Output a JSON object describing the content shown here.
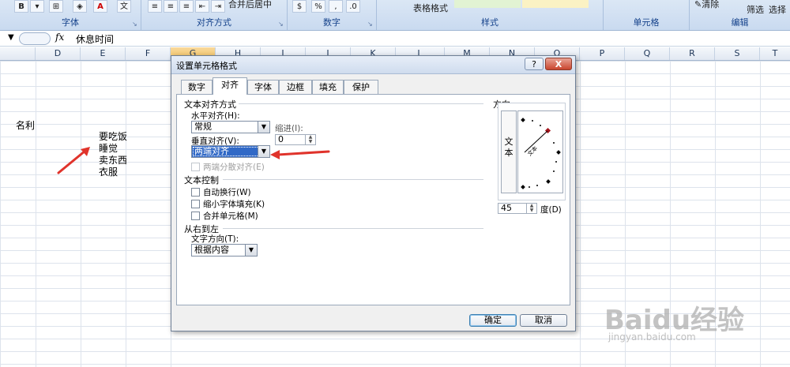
{
  "ribbon": {
    "groups": [
      "字体",
      "对齐方式",
      "数字",
      "样式",
      "单元格",
      "编辑"
    ],
    "merge_label": "合并后居中",
    "table_format_label": "表格格式",
    "clear_label": "清除",
    "filter_label": "筛选",
    "select_label": "选择"
  },
  "formula_bar": {
    "fx": "fx",
    "content": "休息时间"
  },
  "columns": [
    "D",
    "E",
    "F",
    "G",
    "H",
    "I",
    "J",
    "K",
    "L",
    "M",
    "N",
    "O",
    "P",
    "Q",
    "R",
    "S",
    "T"
  ],
  "cells": {
    "c_name": "名利",
    "e1": "要吃饭",
    "e2": "睡觉",
    "e3": "卖东西",
    "e4": "衣服"
  },
  "dialog": {
    "title": "设置单元格格式",
    "help": "?",
    "close": "X",
    "tabs": [
      "数字",
      "对齐",
      "字体",
      "边框",
      "填充",
      "保护"
    ],
    "active_tab": "对齐",
    "text_align_section": "文本对齐方式",
    "horizontal_label": "水平对齐(H):",
    "horizontal_value": "常规",
    "indent_label": "缩进(I):",
    "indent_value": "0",
    "vertical_label": "垂直对齐(V):",
    "vertical_value": "两端对齐",
    "distributed_label": "两端分散对齐(E)",
    "text_control_section": "文本控制",
    "wrap_label": "自动换行(W)",
    "shrink_label": "缩小字体填充(K)",
    "merge_label": "合并单元格(M)",
    "rtl_section": "从右到左",
    "text_direction_label": "文字方向(T):",
    "text_direction_value": "根据内容",
    "orientation_section": "方向",
    "orientation_vertical_text": [
      "文",
      "本"
    ],
    "orientation_arc_text": "文本",
    "degrees_value": "45",
    "degrees_label": "度(D)",
    "ok": "确定",
    "cancel": "取消"
  },
  "watermark": {
    "brand": "Baidu经验",
    "url": "jingyan.baidu.com"
  },
  "colors": {
    "annotation_red": "#e0332b",
    "selection_blue": "#3169c6"
  }
}
